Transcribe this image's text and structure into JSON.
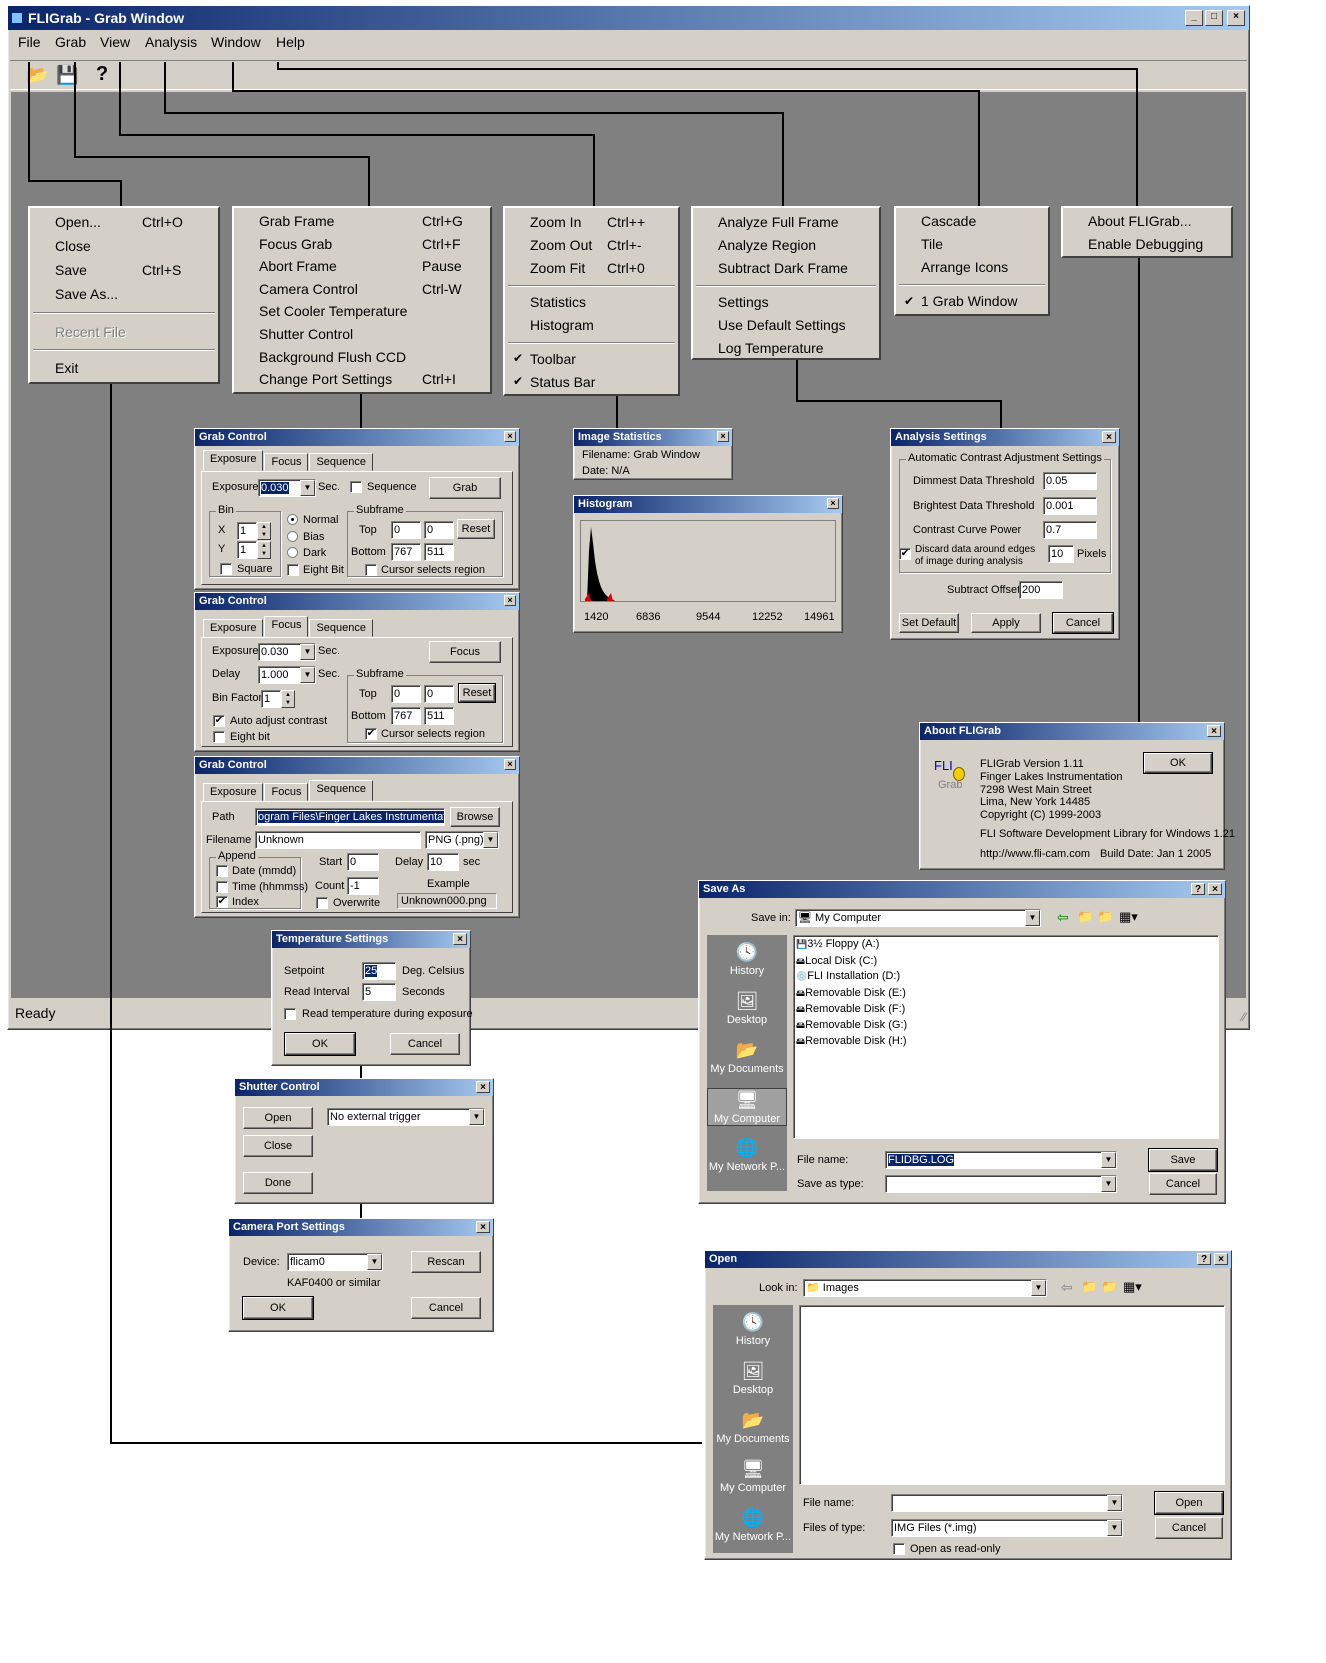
{
  "main": {
    "title": "FLIGrab - Grab Window",
    "menus": [
      "File",
      "Grab",
      "View",
      "Analysis",
      "Window",
      "Help"
    ],
    "status": "Ready",
    "ctrl": [
      "_",
      "□",
      "×"
    ]
  },
  "file_menu": {
    "items": [
      [
        "Open...",
        "Ctrl+O"
      ],
      [
        "Close",
        ""
      ],
      [
        "Save",
        "Ctrl+S"
      ],
      [
        "Save As...",
        ""
      ]
    ],
    "recent": "Recent File",
    "exit": "Exit"
  },
  "grab_menu": {
    "items": [
      [
        "Grab Frame",
        "Ctrl+G"
      ],
      [
        "Focus Grab",
        "Ctrl+F"
      ],
      [
        "Abort Frame",
        "Pause"
      ],
      [
        "Camera Control",
        "Ctrl-W"
      ],
      [
        "Set Cooler Temperature",
        ""
      ],
      [
        "Shutter Control",
        ""
      ],
      [
        "Background Flush CCD",
        ""
      ],
      [
        "Change Port Settings",
        "Ctrl+I"
      ]
    ]
  },
  "view_menu": {
    "items": [
      [
        "Zoom In",
        "Ctrl++"
      ],
      [
        "Zoom Out",
        "Ctrl+-"
      ],
      [
        "Zoom Fit",
        "Ctrl+0"
      ]
    ],
    "items2": [
      "Statistics",
      "Histogram"
    ],
    "items3": [
      "Toolbar",
      "Status Bar"
    ],
    "check": "✔"
  },
  "analysis_menu": {
    "items": [
      "Analyze Full Frame",
      "Analyze Region",
      "Subtract Dark Frame"
    ],
    "items2": [
      "Settings",
      "Use Default Settings",
      "Log Temperature"
    ]
  },
  "window_menu": {
    "items": [
      "Cascade",
      "Tile",
      "Arrange Icons"
    ],
    "checked": "1 Grab Window",
    "check": "✔"
  },
  "help_menu": {
    "items": [
      "About FLIGrab...",
      "Enable Debugging"
    ]
  },
  "gc": {
    "title": "Grab Control",
    "tabs": [
      "Exposure",
      "Focus",
      "Sequence"
    ],
    "exposure": "Exposure",
    "exp_val": "0.030",
    "sec": "Sec.",
    "sequence": "Sequence",
    "grab": "Grab",
    "bin": "Bin",
    "x": "X",
    "y": "Y",
    "one": "1",
    "square": "Square",
    "normal": "Normal",
    "bias": "Bias",
    "dark": "Dark",
    "eightbit": "Eight Bit",
    "subframe": "Subframe",
    "top": "Top",
    "bottom": "Bottom",
    "zero": "0",
    "v767": "767",
    "v511": "511",
    "reset": "Reset",
    "cursor": "Cursor selects region",
    "focus": "Focus",
    "delay": "Delay",
    "delay_val": "1.000",
    "binfactor": "Bin Factor",
    "auto": "Auto adjust contrast",
    "eightbit2": "Eight bit",
    "path": "Path",
    "path_val": "ogram Files\\Finger Lakes Instrumentation",
    "browse": "Browse",
    "filename": "Filename",
    "fn_val": "Unknown",
    "fmt": "PNG (.png)",
    "append": "Append",
    "date": "Date (mmdd)",
    "time": "Time (hhmmss)",
    "index": "Index",
    "start": "Start",
    "count": "Count",
    "count_val": "-1",
    "delay2": "Delay",
    "delay2_val": "10",
    "sec2": "sec",
    "overwrite": "Overwrite",
    "example": "Example",
    "example_val": "Unknown000.png"
  },
  "stats": {
    "title": "Image Statistics",
    "fn": "Filename: Grab Window",
    "date": "Date: N/A"
  },
  "hist": {
    "title": "Histogram",
    "ticks": [
      "1420",
      "6836",
      "9544",
      "12252",
      "14961"
    ]
  },
  "as": {
    "title": "Analysis Settings",
    "group": "Automatic Contrast Adjustment Settings",
    "dim": "Dimmest Data Threshold",
    "dim_v": "0.05",
    "bri": "Brightest Data Threshold",
    "bri_v": "0.001",
    "ccp": "Contrast Curve Power",
    "ccp_v": "0.7",
    "disc1": "Discard data around edges",
    "disc2": "of image during analysis",
    "disc_v": "10",
    "pixels": "Pixels",
    "sub": "Subtract Offset",
    "sub_v": "200",
    "setdef": "Set Default",
    "apply": "Apply",
    "cancel": "Cancel"
  },
  "about": {
    "title": "About FLIGrab",
    "logo1": "FLI",
    "logo2": "Grab",
    "l1": "FLIGrab Version 1.11",
    "l2": "Finger Lakes Instrumentation",
    "l3": "7298 West Main Street",
    "l4": "Lima, New York 14485",
    "l5": "Copyright (C) 1999-2003",
    "l6": "FLI Software Development Library for Windows 1.21",
    "url": "http://www.fli-cam.com",
    "build": "Build Date: Jan  1 2005",
    "ok": "OK"
  },
  "temp": {
    "title": "Temperature Settings",
    "setpoint": "Setpoint",
    "sp_v": "25",
    "degc": "Deg. Celsius",
    "ri": "Read Interval",
    "ri_v": "5",
    "seconds": "Seconds",
    "read": "Read temperature during exposure",
    "ok": "OK",
    "cancel": "Cancel"
  },
  "shutter": {
    "title": "Shutter Control",
    "open": "Open",
    "close": "Close",
    "done": "Done",
    "trigger": "No external trigger"
  },
  "port": {
    "title": "Camera Port Settings",
    "device": "Device:",
    "dev_v": "flicam0",
    "rescan": "Rescan",
    "kaf": "KAF0400 or similar",
    "ok": "OK",
    "cancel": "Cancel"
  },
  "saveas": {
    "title": "Save As",
    "savein": "Save in:",
    "loc": "My Computer",
    "drives": [
      "3½ Floppy (A:)",
      "Local Disk (C:)",
      "FLI Installation (D:)",
      "Removable Disk (E:)",
      "Removable Disk (F:)",
      "Removable Disk (G:)",
      "Removable Disk (H:)"
    ],
    "places": [
      "History",
      "Desktop",
      "My Documents",
      "My Computer",
      "My Network P..."
    ],
    "fname": "File name:",
    "fname_v": "FLIDBG.LOG",
    "ftype": "Save as type:",
    "save": "Save",
    "cancel": "Cancel",
    "q": "?"
  },
  "open": {
    "title": "Open",
    "lookin": "Look in:",
    "loc": "Images",
    "places": [
      "History",
      "Desktop",
      "My Documents",
      "My Computer",
      "My Network P..."
    ],
    "fname": "File name:",
    "ftype": "Files of type:",
    "ftype_v": "IMG Files (*.img)",
    "ro": "Open as read-only",
    "open": "Open",
    "cancel": "Cancel",
    "q": "?"
  }
}
